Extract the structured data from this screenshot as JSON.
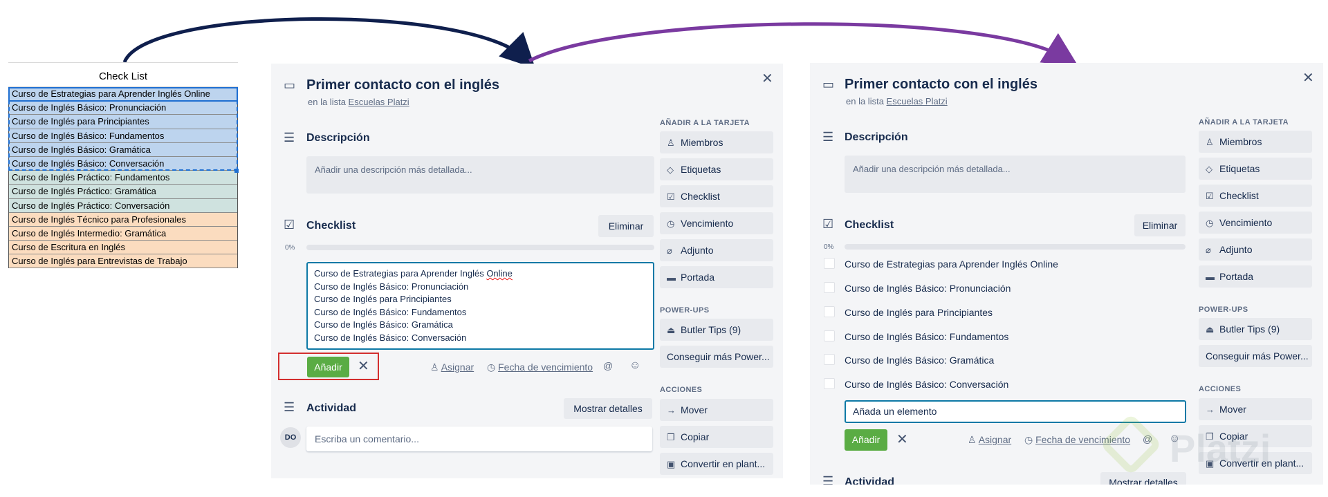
{
  "sheet": {
    "header": "Check List",
    "rows": [
      "Curso de Estrategias para Aprender Inglés Online",
      "Curso de Inglés Básico: Pronunciación",
      "Curso de Inglés para Principiantes",
      "Curso de Inglés Básico: Fundamentos",
      "Curso de Inglés Básico: Gramática",
      "Curso de Inglés Básico: Conversación",
      "Curso de Inglés Práctico: Fundamentos",
      "Curso de Inglés Práctico: Gramática",
      "Curso de Inglés Práctico: Conversación",
      "Curso de Inglés Técnico para Profesionales",
      "Curso de Inglés Intermedio: Gramática",
      "Curso de Escritura en Inglés",
      "Curso de Inglés para Entrevistas de Trabajo"
    ]
  },
  "card": {
    "title": "Primer contacto con el inglés",
    "list_prefix": "en la lista",
    "list_name": "Escuelas Platzi",
    "description_heading": "Descripción",
    "description_placeholder": "Añadir una descripción más detallada...",
    "checklist_heading": "Checklist",
    "delete_label": "Eliminar",
    "progress_label": "0%",
    "progress": 0,
    "add_label": "Añadir",
    "assign_label": "Asignar",
    "due_date_label": "Fecha de vencimiento",
    "mention_glyph": "@",
    "emoji_glyph": "☺",
    "activity_heading": "Actividad",
    "show_details_label": "Mostrar detalles",
    "comment_placeholder": "Escriba un comentario...",
    "avatar_initials": "DO",
    "item_placeholder": "Añada un elemento"
  },
  "checklist_text_lines": [
    "Curso de Estrategias para Aprender Inglés ",
    "Curso de Inglés Básico: Pronunciación",
    "Curso de Inglés para Principiantes",
    "Curso de Inglés Básico: Fundamentos",
    "Curso de Inglés Básico: Gramática",
    "Curso de Inglés Básico: Conversación"
  ],
  "checklist_text_spell_word": "Online",
  "checklist_items": [
    "Curso de Estrategias para Aprender Inglés Online",
    "Curso de Inglés Básico: Pronunciación",
    "Curso de Inglés para Principiantes",
    "Curso de Inglés Básico: Fundamentos",
    "Curso de Inglés Básico: Gramática",
    "Curso de Inglés Básico: Conversación"
  ],
  "sidebar": {
    "add_heading": "AÑADIR A LA TARJETA",
    "add_items": [
      {
        "icon": "person-icon",
        "glyph": "♙",
        "label": "Miembros"
      },
      {
        "icon": "tag-icon",
        "glyph": "◇",
        "label": "Etiquetas"
      },
      {
        "icon": "checkbox-icon",
        "glyph": "☑",
        "label": "Checklist"
      },
      {
        "icon": "clock-icon",
        "glyph": "◷",
        "label": "Vencimiento"
      },
      {
        "icon": "paperclip-icon",
        "glyph": "⌀",
        "label": "Adjunto"
      },
      {
        "icon": "cover-icon",
        "glyph": "▬",
        "label": "Portada"
      }
    ],
    "powerups_heading": "POWER-UPS",
    "butler_label": "Butler Tips (9)",
    "more_powerups_label": "Conseguir más Power...",
    "actions_heading": "ACCIONES",
    "action_items": [
      {
        "icon": "arrow-right-icon",
        "glyph": "→",
        "label": "Mover"
      },
      {
        "icon": "copy-icon",
        "glyph": "❐",
        "label": "Copiar"
      },
      {
        "icon": "template-icon",
        "glyph": "▣",
        "label": "Convertir en plant..."
      }
    ]
  },
  "watermark": "Platzi",
  "colors": {
    "card_bg": "#f4f5f7",
    "button_green": "#5aac44",
    "focus_border": "#0d79a6",
    "arrow_navy": "#0f1f4d",
    "arrow_purple": "#7a3aa0",
    "highlight_red": "#d32f2f",
    "sheet_blue": "#bdd4ee",
    "sheet_teal": "#cfe2df",
    "sheet_orange": "#fbdcbf"
  }
}
